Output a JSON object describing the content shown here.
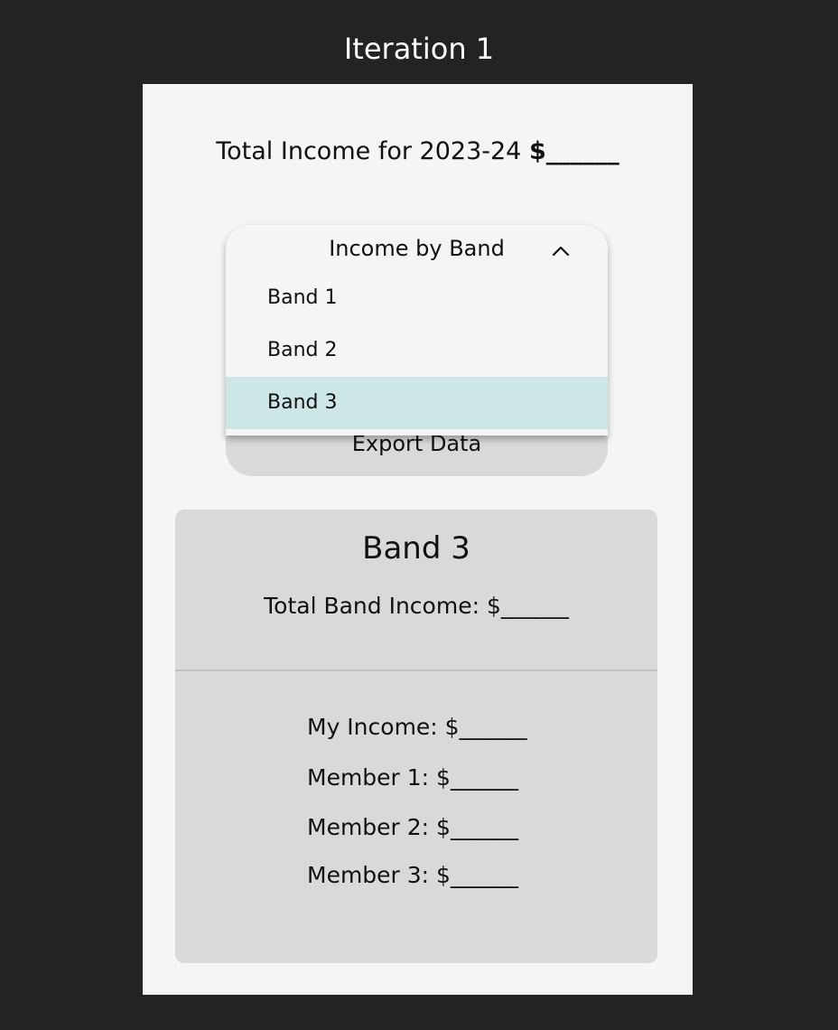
{
  "canvas": {
    "title": "Iteration 1"
  },
  "summary": {
    "label": "Total Income for 2023-24",
    "value": "$______"
  },
  "dropdown": {
    "title": "Income by Band",
    "options": [
      {
        "label": "Band 1"
      },
      {
        "label": "Band 2"
      },
      {
        "label": "Band 3"
      }
    ],
    "selected": "Band 3",
    "chevron_icon": "chevron-up-icon"
  },
  "export": {
    "label": "Export Data"
  },
  "band_card": {
    "title": "Band 3",
    "total": "Total Band Income: $______",
    "members": [
      "My Income: $______",
      "Member 1: $______",
      "Member 2: $______",
      "Member 3: $______"
    ]
  },
  "colors": {
    "background": "#232323",
    "frame": "#f5f5f5",
    "card": "#d9d9d9",
    "selected_option": "#cde7e7"
  }
}
